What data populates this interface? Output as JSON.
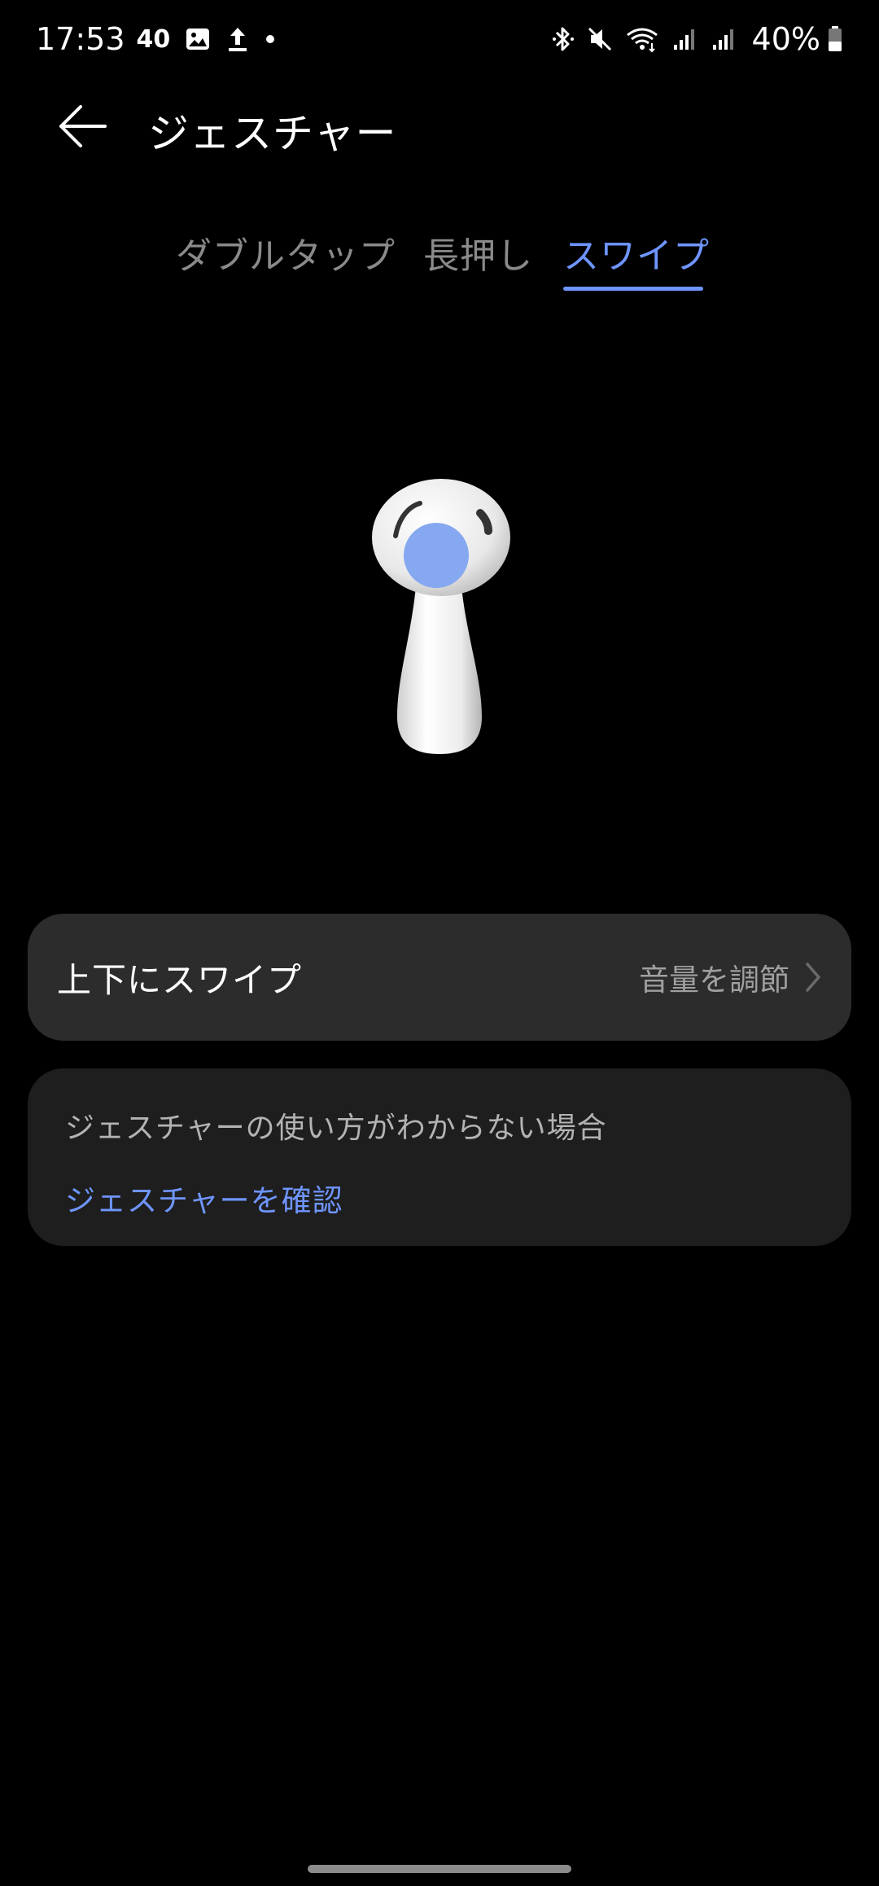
{
  "status_bar": {
    "time": "17:53",
    "notification_count": "40",
    "battery_percent": "40%",
    "icons": [
      "gallery-icon",
      "upload-icon",
      "dot-icon",
      "bluetooth-icon",
      "mute-icon",
      "wifi-icon",
      "signal-icon",
      "battery-icon"
    ]
  },
  "header": {
    "title": "ジェスチャー",
    "back_icon": "back-arrow-icon"
  },
  "tabs": [
    {
      "label": "ダブルタップ",
      "active": false
    },
    {
      "label": "長押し",
      "active": false
    },
    {
      "label": "スワイプ",
      "active": true
    }
  ],
  "swipe_setting": {
    "label": "上下にスワイプ",
    "value": "音量を調節",
    "chevron_icon": "chevron-right-icon"
  },
  "help": {
    "text": "ジェスチャーの使い方がわからない場合",
    "link": "ジェスチャーを確認"
  },
  "colors": {
    "accent": "#6f95ff",
    "background": "#000000",
    "card": "#2c2c2c",
    "help_card": "#1e1e1e"
  }
}
